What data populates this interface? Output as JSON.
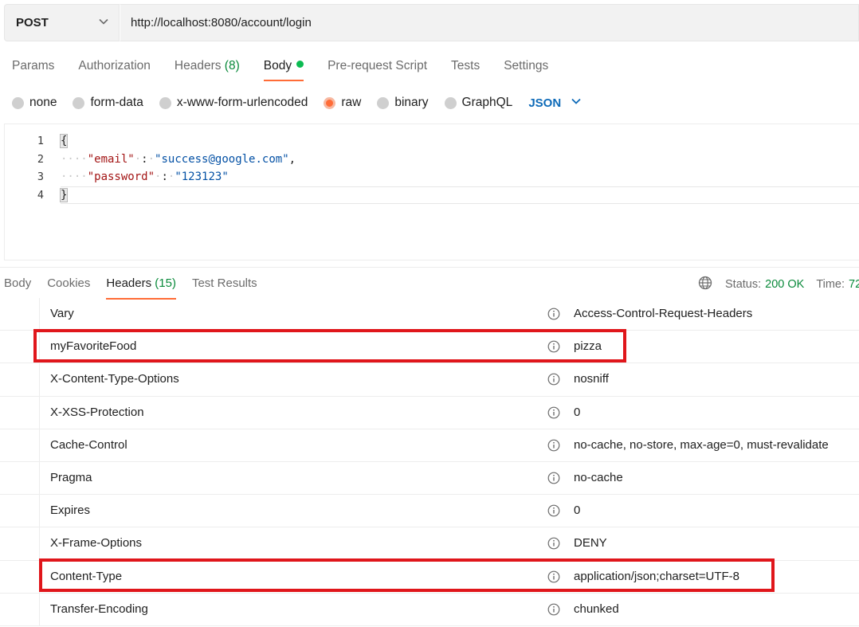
{
  "request": {
    "method": "POST",
    "url": "http://localhost:8080/account/login"
  },
  "request_tabs": [
    {
      "label": "Params",
      "count": ""
    },
    {
      "label": "Authorization",
      "count": ""
    },
    {
      "label": "Headers",
      "count": "(8)"
    },
    {
      "label": "Body",
      "count": ""
    },
    {
      "label": "Pre-request Script",
      "count": ""
    },
    {
      "label": "Tests",
      "count": ""
    },
    {
      "label": "Settings",
      "count": ""
    }
  ],
  "body_types": [
    "none",
    "form-data",
    "x-www-form-urlencoded",
    "raw",
    "binary",
    "GraphQL"
  ],
  "body_format": "JSON",
  "editor": {
    "line_numbers": [
      "1",
      "2",
      "3",
      "4"
    ],
    "open_brace": "{",
    "close_brace": "}",
    "lines": [
      {
        "key": "\"email\"",
        "value": "\"success@google.com\"",
        "trailing": ","
      },
      {
        "key": "\"password\"",
        "value": "\"123123\"",
        "trailing": ""
      }
    ]
  },
  "response_tabs": [
    {
      "label": "Body",
      "count": ""
    },
    {
      "label": "Cookies",
      "count": ""
    },
    {
      "label": "Headers",
      "count": "(15)"
    },
    {
      "label": "Test Results",
      "count": ""
    }
  ],
  "status": {
    "label": "Status:",
    "value": "200 OK",
    "time_label": "Time:",
    "time_value": "72"
  },
  "headers": [
    {
      "key": "Vary",
      "value": "Access-Control-Request-Headers"
    },
    {
      "key": "myFavoriteFood",
      "value": "pizza"
    },
    {
      "key": "X-Content-Type-Options",
      "value": "nosniff"
    },
    {
      "key": "X-XSS-Protection",
      "value": "0"
    },
    {
      "key": "Cache-Control",
      "value": "no-cache, no-store, max-age=0, must-revalidate"
    },
    {
      "key": "Pragma",
      "value": "no-cache"
    },
    {
      "key": "Expires",
      "value": "0"
    },
    {
      "key": "X-Frame-Options",
      "value": "DENY"
    },
    {
      "key": "Content-Type",
      "value": "application/json;charset=UTF-8"
    },
    {
      "key": "Transfer-Encoding",
      "value": "chunked"
    }
  ],
  "colors": {
    "accent": "#ff6c37",
    "success": "#0a8a3b",
    "annotation": "#e0161b",
    "link": "#0d6ab8"
  }
}
